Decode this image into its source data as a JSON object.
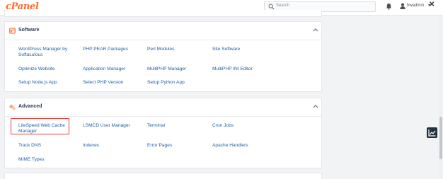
{
  "app": {
    "logo": "cPanel"
  },
  "header": {
    "search_placeholder": "Search",
    "username": "hwadmin"
  },
  "sections": [
    {
      "title": "Software",
      "items": [
        "WordPress Manager by Softaculous",
        "PHP PEAR Packages",
        "Perl Modules",
        "Site Software",
        "Optimize Website",
        "Application Manager",
        "MultiPHP Manager",
        "MultiPHP INI Editor",
        "Setup Node.js App",
        "Select PHP Version",
        "Setup Python App"
      ]
    },
    {
      "title": "Advanced",
      "items": [
        "LiteSpeed Web Cache Manager",
        "LSMCD User Manager",
        "Terminal",
        "Cron Jobs",
        "Track DNS",
        "Indexes",
        "Error Pages",
        "Apache Handlers",
        "MIME Types"
      ]
    }
  ],
  "colors": {
    "brand": "#ff6c2c",
    "link": "#1f5ea8",
    "highlight": "#e0403a"
  },
  "icons": {
    "software": "software-box-icon",
    "advanced": "gears-icon",
    "collapse": "chevron-up-icon",
    "floating": "chart-trend-icon"
  }
}
